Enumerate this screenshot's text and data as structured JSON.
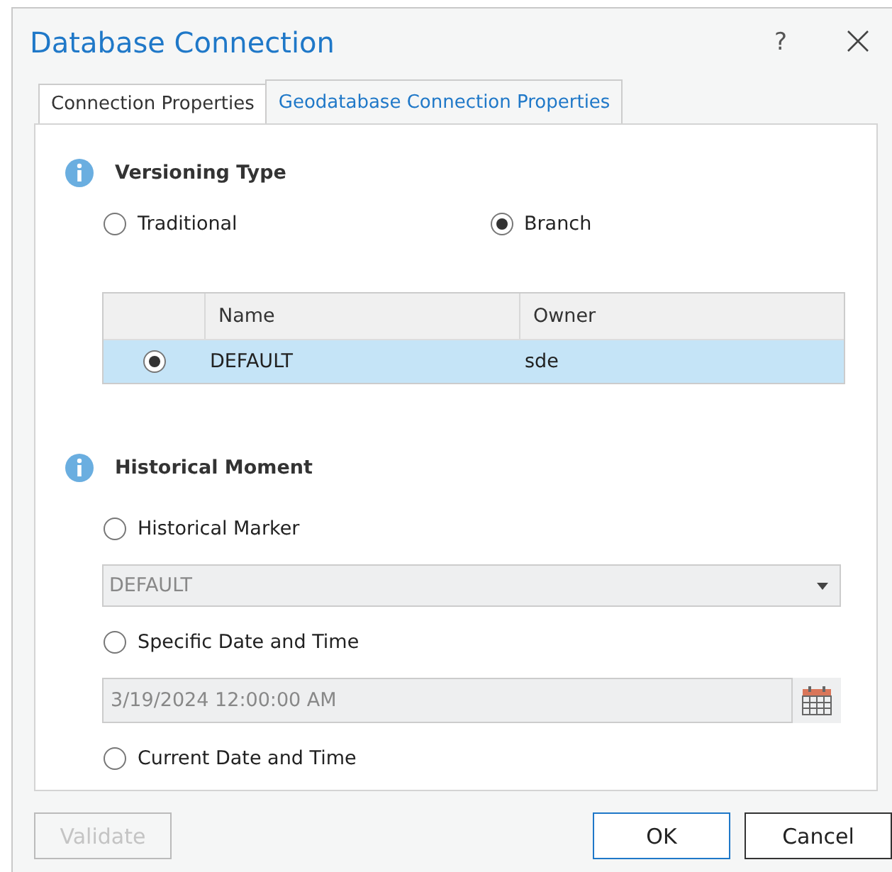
{
  "window": {
    "title": "Database Connection",
    "help": "?"
  },
  "tabs": [
    {
      "label": "Connection Properties",
      "selected": false
    },
    {
      "label": "Geodatabase Connection Properties",
      "selected": true
    }
  ],
  "versioning": {
    "title": "Versioning Type",
    "options": [
      {
        "label": "Traditional",
        "selected": false
      },
      {
        "label": "Branch",
        "selected": true
      }
    ],
    "table": {
      "columns": [
        "Name",
        "Owner"
      ],
      "rows": [
        {
          "selected": true,
          "name": "DEFAULT",
          "owner": "sde"
        }
      ]
    }
  },
  "historical": {
    "title": "Historical Moment",
    "items": [
      {
        "kind": "radio",
        "label": "Historical Marker",
        "selected": false
      },
      {
        "kind": "dropdown",
        "value": "DEFAULT",
        "disabled": true
      },
      {
        "kind": "radio",
        "label": "Specific Date and Time",
        "selected": false
      },
      {
        "kind": "date",
        "value": "3/19/2024 12:00:00 AM",
        "disabled": true
      },
      {
        "kind": "radio",
        "label": "Current Date and Time",
        "selected": false
      }
    ]
  },
  "buttons": [
    {
      "label": "Validate",
      "disabled": true,
      "default": false
    },
    {
      "label": "OK",
      "disabled": false,
      "default": true
    },
    {
      "label": "Cancel",
      "disabled": false,
      "default": false
    }
  ]
}
